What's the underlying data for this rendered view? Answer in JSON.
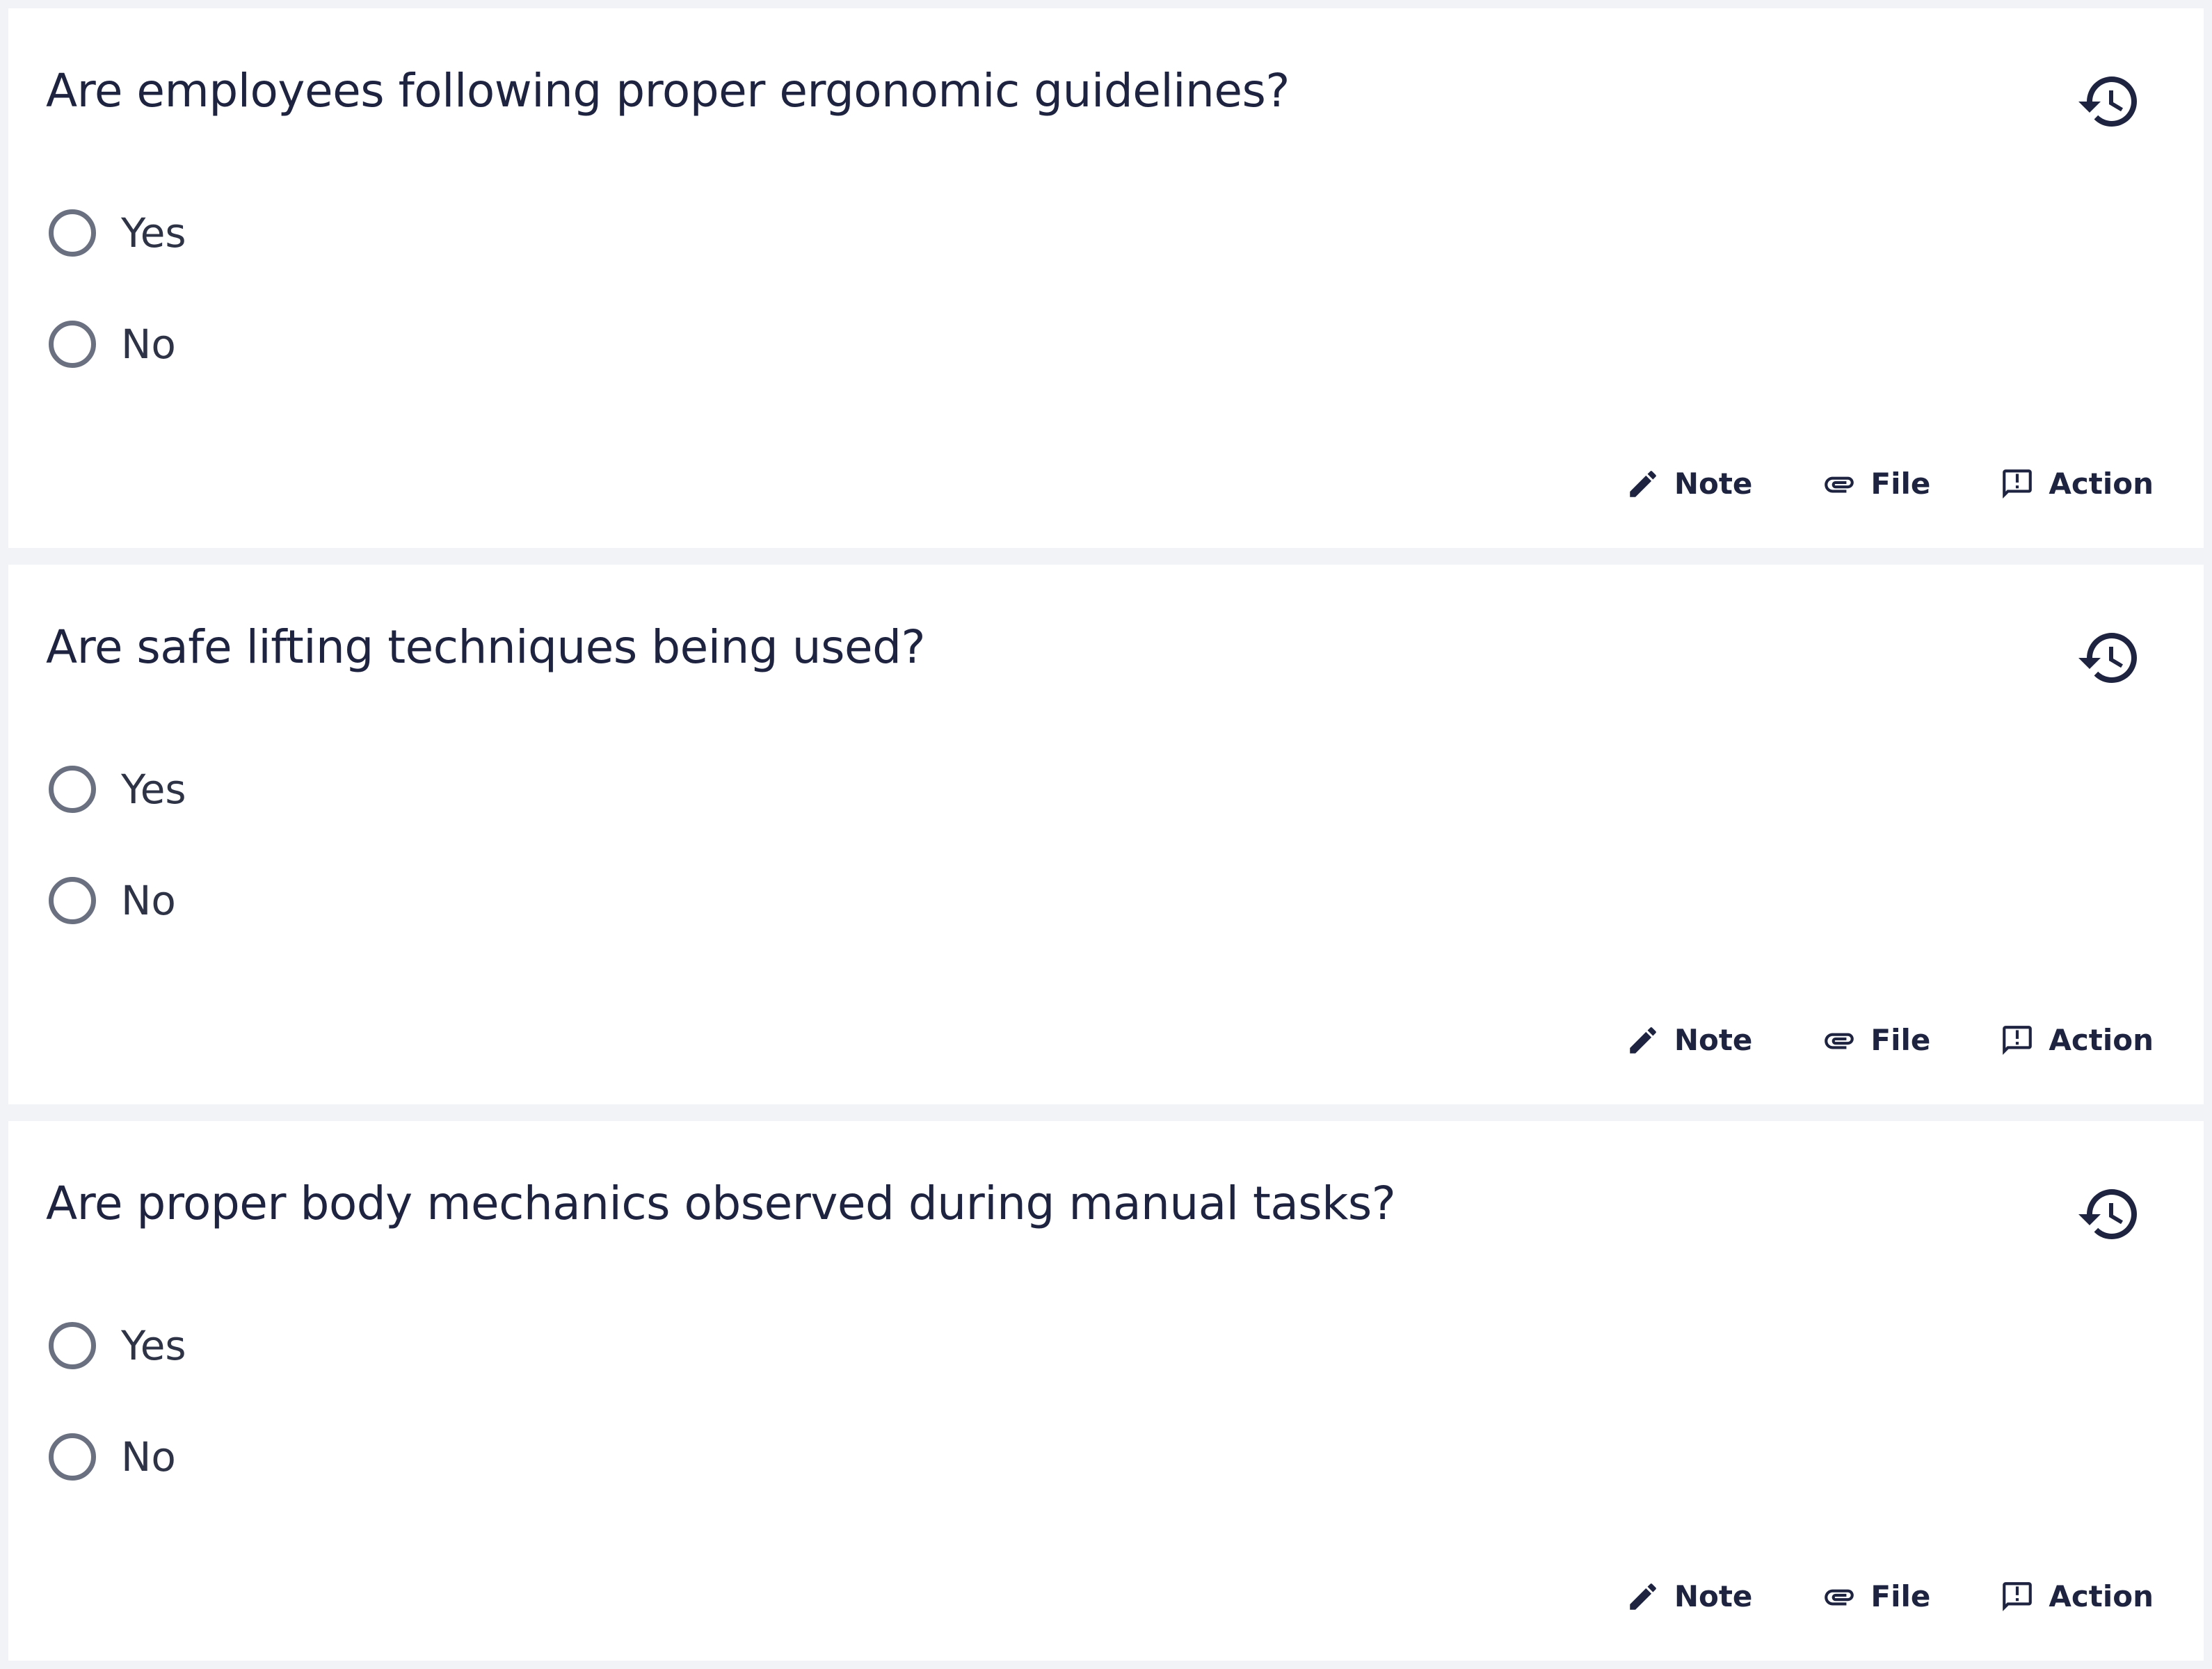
{
  "questions": [
    {
      "title": "Are employees following proper ergonomic guidelines?",
      "options": [
        "Yes",
        "No"
      ],
      "actions": {
        "note": "Note",
        "file": "File",
        "action": "Action"
      }
    },
    {
      "title": "Are safe lifting techniques being used?",
      "options": [
        "Yes",
        "No"
      ],
      "actions": {
        "note": "Note",
        "file": "File",
        "action": "Action"
      }
    },
    {
      "title": "Are proper body mechanics observed during manual tasks?",
      "options": [
        "Yes",
        "No"
      ],
      "actions": {
        "note": "Note",
        "file": "File",
        "action": "Action"
      }
    }
  ],
  "icons": {
    "history": "history-icon",
    "note": "pencil-icon",
    "file": "paperclip-icon",
    "action": "report-icon"
  },
  "colors": {
    "background": "#f1f3f6",
    "card": "#ffffff",
    "text": "#1e2340",
    "radio_border": "#6a7080"
  }
}
